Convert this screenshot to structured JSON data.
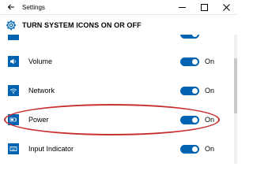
{
  "window": {
    "title": "Settings",
    "back_icon": "back-arrow-icon",
    "minimize_icon": "minimize-icon",
    "maximize_icon": "maximize-icon",
    "close_icon": "close-icon"
  },
  "header": {
    "icon": "gear-icon",
    "title": "TURN SYSTEM ICONS ON OR OFF"
  },
  "accent_color": "#0063b1",
  "highlight_color": "#c8302f",
  "items": [
    {
      "label": "",
      "state": "",
      "icon": "partial-icon",
      "on": true
    },
    {
      "label": "Volume",
      "state": "On",
      "icon": "speaker-icon",
      "on": true
    },
    {
      "label": "Network",
      "state": "On",
      "icon": "network-icon",
      "on": true
    },
    {
      "label": "Power",
      "state": "On",
      "icon": "battery-icon",
      "on": true
    },
    {
      "label": "Input Indicator",
      "state": "On",
      "icon": "keyboard-icon",
      "on": true
    }
  ]
}
